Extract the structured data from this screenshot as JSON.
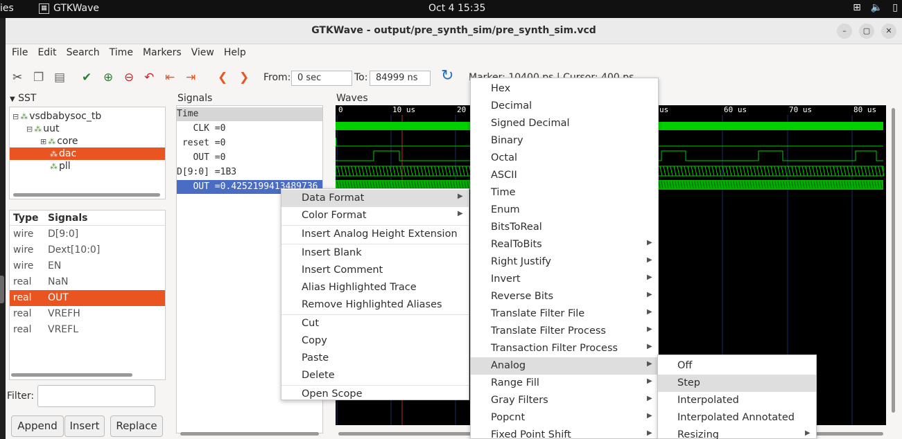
{
  "topbar": {
    "activities": "ies",
    "app_name": "GTKWave",
    "clock": "Oct 4  15:35",
    "tray_icons": [
      "network-icon",
      "volume-icon",
      "battery-icon"
    ]
  },
  "window": {
    "title": "GTKWave - output/pre_synth_sim/pre_synth_sim.vcd",
    "controls": [
      "minimize",
      "maximize",
      "close"
    ]
  },
  "menubar": [
    "File",
    "Edit",
    "Search",
    "Time",
    "Markers",
    "View",
    "Help"
  ],
  "toolbar": {
    "from_label": "From:",
    "from_value": "0 sec",
    "to_label": "To:",
    "to_value": "84999 ns",
    "marker_text": "Marker: 10400 ps  |  Cursor: 400 ps"
  },
  "sst": {
    "heading": "SST",
    "tree": [
      {
        "label": "vsdbabysoc_tb",
        "level": 0
      },
      {
        "label": "uut",
        "level": 1
      },
      {
        "label": "core",
        "level": 2
      },
      {
        "label": "dac",
        "level": 2,
        "selected": true
      },
      {
        "label": "pll",
        "level": 2
      }
    ]
  },
  "signal_list": {
    "col_type": "Type",
    "col_signals": "Signals",
    "rows": [
      {
        "type": "wire",
        "name": "D[9:0]"
      },
      {
        "type": "wire",
        "name": "Dext[10:0]"
      },
      {
        "type": "wire",
        "name": "EN"
      },
      {
        "type": "real",
        "name": "NaN"
      },
      {
        "type": "real",
        "name": "OUT",
        "selected": true
      },
      {
        "type": "real",
        "name": "VREFH"
      },
      {
        "type": "real",
        "name": "VREFL"
      }
    ]
  },
  "filter": {
    "label": "Filter:",
    "value": ""
  },
  "buttons": {
    "append": "Append",
    "insert": "Insert",
    "replace": "Replace"
  },
  "signals_pane": {
    "heading": "Signals",
    "lines": [
      {
        "text": "Time",
        "style": "hl"
      },
      {
        "text": "   CLK =0",
        "style": ""
      },
      {
        "text": " reset =0",
        "style": ""
      },
      {
        "text": "   OUT =0",
        "style": ""
      },
      {
        "text": "D[9:0] =1B3",
        "style": ""
      },
      {
        "text": "   OUT =0.4252199413489736",
        "style": "blue"
      }
    ]
  },
  "waves": {
    "heading": "Waves",
    "time_labels": [
      "0",
      "10 us",
      "20 us",
      "us",
      "60 us",
      "70 us",
      "80 us"
    ]
  },
  "context_menu": {
    "items": [
      {
        "label": "Data Format",
        "submenu": true,
        "highlight": true
      },
      {
        "label": "Color Format",
        "submenu": true
      },
      {
        "sep": true
      },
      {
        "label": "Insert Analog Height Extension"
      },
      {
        "sep": true
      },
      {
        "label": "Insert Blank"
      },
      {
        "label": "Insert Comment"
      },
      {
        "label": "Alias Highlighted Trace"
      },
      {
        "label": "Remove Highlighted Aliases"
      },
      {
        "sep": true
      },
      {
        "label": "Cut"
      },
      {
        "label": "Copy"
      },
      {
        "label": "Paste"
      },
      {
        "label": "Delete"
      },
      {
        "sep": true
      },
      {
        "label": "Open Scope"
      }
    ]
  },
  "data_format_menu": {
    "items": [
      {
        "label": "Hex"
      },
      {
        "label": "Decimal"
      },
      {
        "label": "Signed Decimal"
      },
      {
        "label": "Binary"
      },
      {
        "label": "Octal"
      },
      {
        "label": "ASCII"
      },
      {
        "label": "Time"
      },
      {
        "label": "Enum"
      },
      {
        "label": "BitsToReal"
      },
      {
        "label": "RealToBits",
        "submenu": true
      },
      {
        "label": "Right Justify",
        "submenu": true
      },
      {
        "label": "Invert",
        "submenu": true
      },
      {
        "label": "Reverse Bits",
        "submenu": true
      },
      {
        "label": "Translate Filter File",
        "submenu": true
      },
      {
        "label": "Translate Filter Process",
        "submenu": true
      },
      {
        "label": "Transaction Filter Process",
        "submenu": true
      },
      {
        "label": "Analog",
        "submenu": true,
        "highlight": true
      },
      {
        "label": "Range Fill",
        "submenu": true
      },
      {
        "label": "Gray Filters",
        "submenu": true
      },
      {
        "label": "Popcnt",
        "submenu": true
      },
      {
        "label": "Fixed Point Shift",
        "submenu": true
      }
    ]
  },
  "analog_menu": {
    "items": [
      {
        "label": "Off"
      },
      {
        "label": "Step",
        "highlight": true
      },
      {
        "label": "Interpolated"
      },
      {
        "label": "Interpolated Annotated"
      },
      {
        "label": "Resizing",
        "submenu": true
      }
    ]
  }
}
